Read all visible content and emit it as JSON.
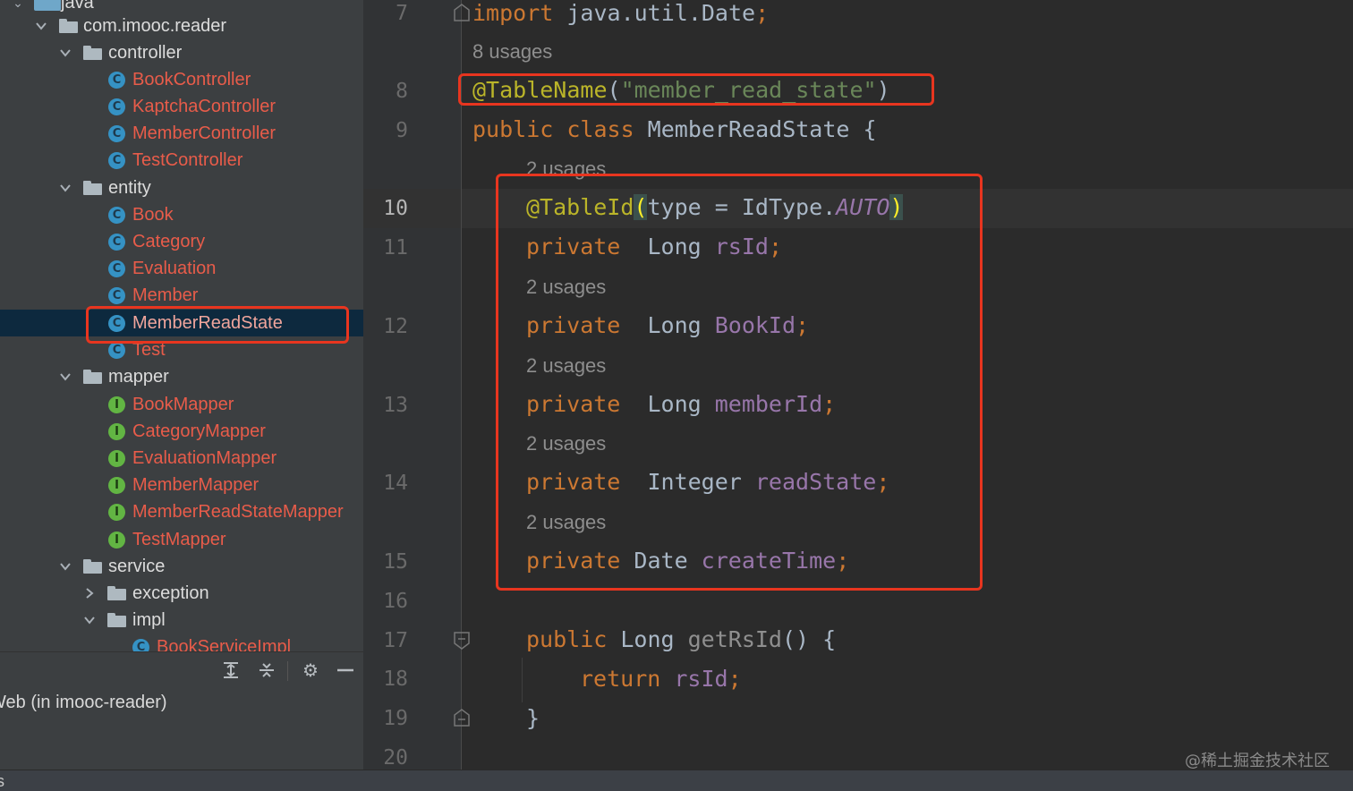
{
  "tree": {
    "items": [
      {
        "label": "java",
        "kind": "folder-top"
      },
      {
        "label": "com.imooc.reader",
        "kind": "package",
        "expanded": true
      },
      {
        "label": "controller",
        "kind": "package",
        "expanded": true
      },
      {
        "label": "BookController",
        "kind": "class"
      },
      {
        "label": "KaptchaController",
        "kind": "class"
      },
      {
        "label": "MemberController",
        "kind": "class"
      },
      {
        "label": "TestController",
        "kind": "class"
      },
      {
        "label": "entity",
        "kind": "package",
        "expanded": true
      },
      {
        "label": "Book",
        "kind": "class"
      },
      {
        "label": "Category",
        "kind": "class"
      },
      {
        "label": "Evaluation",
        "kind": "class"
      },
      {
        "label": "Member",
        "kind": "class"
      },
      {
        "label": "MemberReadState",
        "kind": "class",
        "selected": true
      },
      {
        "label": "Test",
        "kind": "class"
      },
      {
        "label": "mapper",
        "kind": "package",
        "expanded": true
      },
      {
        "label": "BookMapper",
        "kind": "interface"
      },
      {
        "label": "CategoryMapper",
        "kind": "interface"
      },
      {
        "label": "EvaluationMapper",
        "kind": "interface"
      },
      {
        "label": "MemberMapper",
        "kind": "interface"
      },
      {
        "label": "MemberReadStateMapper",
        "kind": "interface"
      },
      {
        "label": "TestMapper",
        "kind": "interface"
      },
      {
        "label": "service",
        "kind": "package",
        "expanded": true
      },
      {
        "label": "exception",
        "kind": "package",
        "expanded": false
      },
      {
        "label": "impl",
        "kind": "package",
        "expanded": true
      },
      {
        "label": "BookServiceImpl",
        "kind": "class"
      }
    ],
    "class_icon_letter": "C",
    "interface_icon_letter": "I"
  },
  "toolbar": {
    "icons": [
      "expand-all-icon",
      "collapse-all-icon",
      "gear-icon",
      "minimize-icon"
    ]
  },
  "run_panel": {
    "label": "Web (in imooc-reader)"
  },
  "statusbar": {
    "text": "s"
  },
  "editor": {
    "line_numbers": [
      "7",
      "8",
      "9",
      "10",
      "11",
      "12",
      "13",
      "14",
      "15",
      "16",
      "17",
      "18",
      "19",
      "20"
    ],
    "usages": [
      "8 usages",
      "2 usages",
      "2 usages",
      "2 usages",
      "2 usages",
      "2 usages"
    ],
    "code": {
      "l7_kw": "import",
      "l7_rest": " java.util.Date",
      "semicolon": ";",
      "l8_ann": "@TableName",
      "l8_open": "(",
      "l8_str": "\"member_read_state\"",
      "l8_close": ")",
      "l9_kw": "public class",
      "l9_rest": " MemberReadState {",
      "l10_ann": "@TableId",
      "l10_open": "(",
      "l10_mid": "type = IdType.",
      "l10_const": "AUTO",
      "l10_close": ")",
      "private": "private",
      "l11_type": "  Long ",
      "l11_field": "rsId",
      "l12_type": "  Long ",
      "l12_field": "BookId",
      "l13_type": "  Long ",
      "l13_field": "memberId",
      "l14_type": "  Integer ",
      "l14_field": "readState",
      "l15_type": " Date ",
      "l15_field": "createTime",
      "l17_kw": "public",
      "l17_type": " Long ",
      "l17_fn": "getRsId",
      "l17_rest": "() {",
      "l18_kw": "return",
      "l18_field": " rsId",
      "l19": "}"
    }
  },
  "watermark": "@稀土掘金技术社区",
  "colors": {
    "highlight_box": "#e8351f",
    "keyword": "#cc7832",
    "annotation": "#bbb529",
    "string": "#6a8759",
    "field": "#9876aa",
    "class_name": "#e85c4a"
  }
}
